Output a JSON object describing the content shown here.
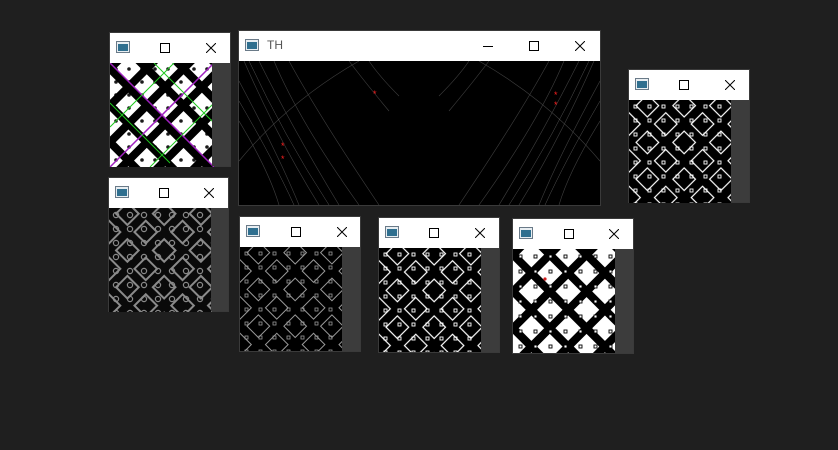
{
  "colors": {
    "desktop": "#1f1f1f",
    "titlebar": "#ffffff",
    "scrollbar": "#3c3c3c"
  },
  "windows": [
    {
      "id": "w1",
      "title": ""
    },
    {
      "id": "w2",
      "title": "TH"
    },
    {
      "id": "w3",
      "title": ""
    },
    {
      "id": "w4",
      "title": ""
    },
    {
      "id": "w5",
      "title": ""
    },
    {
      "id": "w6",
      "title": ""
    },
    {
      "id": "w7",
      "title": ""
    },
    {
      "id": "w8",
      "title": ""
    }
  ],
  "icons": [
    "window-app-icon",
    "minimize-icon",
    "maximize-icon",
    "close-icon"
  ]
}
